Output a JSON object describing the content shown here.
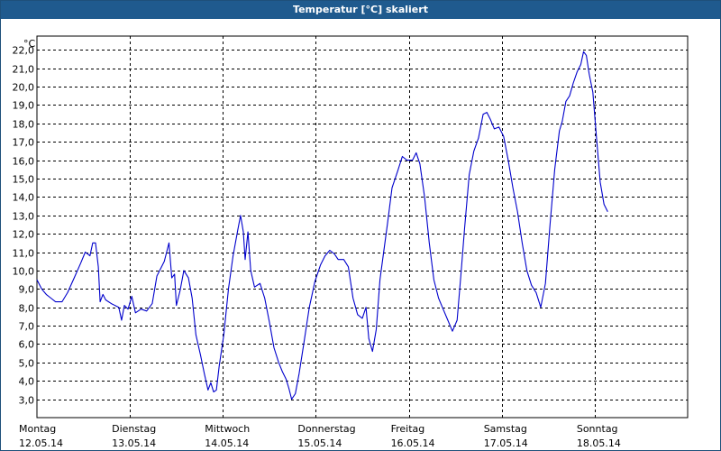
{
  "window": {
    "title": "Temperatur [°C] skaliert"
  },
  "chart_data": {
    "type": "line",
    "title": "Temperatur [°C] skaliert",
    "unit": "°C",
    "ylim": [
      2.0,
      22.75
    ],
    "xlim": [
      0,
      7.0
    ],
    "grid": true,
    "grid_style": "dashed",
    "yticks": [
      3.0,
      4.0,
      5.0,
      6.0,
      7.0,
      8.0,
      9.0,
      10.0,
      11.0,
      12.0,
      13.0,
      14.0,
      15.0,
      16.0,
      17.0,
      18.0,
      19.0,
      20.0,
      21.0,
      22.0
    ],
    "ytick_labels": [
      "3,0",
      "4,0",
      "5,0",
      "6,0",
      "7,0",
      "8,0",
      "9,0",
      "10,0",
      "11,0",
      "12,0",
      "13,0",
      "14,0",
      "15,0",
      "16,0",
      "17,0",
      "18,0",
      "19,0",
      "20,0",
      "21,0",
      "22,0"
    ],
    "days": [
      {
        "name": "Montag",
        "date": "12.05.14"
      },
      {
        "name": "Dienstag",
        "date": "13.05.14"
      },
      {
        "name": "Mittwoch",
        "date": "14.05.14"
      },
      {
        "name": "Donnerstag",
        "date": "15.05.14"
      },
      {
        "name": "Freitag",
        "date": "16.05.14"
      },
      {
        "name": "Samstag",
        "date": "17.05.14"
      },
      {
        "name": "Sonntag",
        "date": "18.05.14"
      }
    ],
    "series": [
      {
        "color": "#0000cc",
        "points": [
          [
            0.0,
            9.5
          ],
          [
            0.05,
            9.0
          ],
          [
            0.1,
            8.7
          ],
          [
            0.15,
            8.5
          ],
          [
            0.2,
            8.3
          ],
          [
            0.27,
            8.3
          ],
          [
            0.33,
            8.8
          ],
          [
            0.4,
            9.6
          ],
          [
            0.47,
            10.4
          ],
          [
            0.52,
            11.0
          ],
          [
            0.57,
            10.8
          ],
          [
            0.6,
            11.5
          ],
          [
            0.63,
            11.5
          ],
          [
            0.66,
            10.2
          ],
          [
            0.68,
            8.3
          ],
          [
            0.71,
            8.7
          ],
          [
            0.74,
            8.4
          ],
          [
            0.8,
            8.2
          ],
          [
            0.88,
            8.0
          ],
          [
            0.91,
            7.3
          ],
          [
            0.94,
            8.1
          ],
          [
            0.98,
            7.9
          ],
          [
            1.02,
            8.6
          ],
          [
            1.06,
            7.7
          ],
          [
            1.12,
            7.9
          ],
          [
            1.18,
            7.8
          ],
          [
            1.24,
            8.2
          ],
          [
            1.29,
            9.7
          ],
          [
            1.33,
            10.1
          ],
          [
            1.37,
            10.5
          ],
          [
            1.42,
            11.5
          ],
          [
            1.45,
            9.6
          ],
          [
            1.48,
            9.8
          ],
          [
            1.5,
            8.1
          ],
          [
            1.54,
            8.9
          ],
          [
            1.58,
            10.0
          ],
          [
            1.63,
            9.6
          ],
          [
            1.67,
            8.5
          ],
          [
            1.71,
            6.5
          ],
          [
            1.76,
            5.4
          ],
          [
            1.8,
            4.4
          ],
          [
            1.84,
            3.5
          ],
          [
            1.87,
            3.9
          ],
          [
            1.9,
            3.4
          ],
          [
            1.93,
            3.5
          ],
          [
            1.96,
            4.8
          ],
          [
            2.01,
            6.5
          ],
          [
            2.06,
            9.0
          ],
          [
            2.11,
            10.8
          ],
          [
            2.16,
            12.2
          ],
          [
            2.19,
            13.0
          ],
          [
            2.22,
            12.1
          ],
          [
            2.24,
            10.6
          ],
          [
            2.27,
            12.1
          ],
          [
            2.3,
            10.0
          ],
          [
            2.34,
            9.1
          ],
          [
            2.4,
            9.3
          ],
          [
            2.45,
            8.5
          ],
          [
            2.5,
            7.2
          ],
          [
            2.55,
            5.8
          ],
          [
            2.6,
            5.0
          ],
          [
            2.64,
            4.5
          ],
          [
            2.68,
            4.1
          ],
          [
            2.71,
            3.6
          ],
          [
            2.74,
            3.0
          ],
          [
            2.78,
            3.3
          ],
          [
            2.82,
            4.4
          ],
          [
            2.87,
            6.0
          ],
          [
            2.93,
            8.0
          ],
          [
            2.99,
            9.4
          ],
          [
            3.05,
            10.3
          ],
          [
            3.1,
            10.8
          ],
          [
            3.15,
            11.1
          ],
          [
            3.2,
            10.9
          ],
          [
            3.24,
            10.6
          ],
          [
            3.3,
            10.6
          ],
          [
            3.35,
            10.2
          ],
          [
            3.4,
            8.5
          ],
          [
            3.45,
            7.6
          ],
          [
            3.5,
            7.4
          ],
          [
            3.54,
            8.0
          ],
          [
            3.57,
            6.3
          ],
          [
            3.61,
            5.6
          ],
          [
            3.65,
            6.8
          ],
          [
            3.69,
            9.5
          ],
          [
            3.73,
            11.0
          ],
          [
            3.77,
            12.5
          ],
          [
            3.82,
            14.5
          ],
          [
            3.88,
            15.4
          ],
          [
            3.93,
            16.2
          ],
          [
            3.98,
            16.0
          ],
          [
            4.04,
            16.0
          ],
          [
            4.08,
            16.4
          ],
          [
            4.12,
            15.8
          ],
          [
            4.17,
            14.0
          ],
          [
            4.22,
            11.5
          ],
          [
            4.27,
            9.5
          ],
          [
            4.32,
            8.5
          ],
          [
            4.37,
            7.9
          ],
          [
            4.42,
            7.3
          ],
          [
            4.47,
            6.7
          ],
          [
            4.52,
            7.3
          ],
          [
            4.56,
            9.7
          ],
          [
            4.6,
            12.3
          ],
          [
            4.65,
            15.2
          ],
          [
            4.7,
            16.5
          ],
          [
            4.75,
            17.2
          ],
          [
            4.8,
            18.5
          ],
          [
            4.84,
            18.6
          ],
          [
            4.88,
            18.2
          ],
          [
            4.92,
            17.7
          ],
          [
            4.97,
            17.8
          ],
          [
            5.02,
            17.3
          ],
          [
            5.07,
            16.0
          ],
          [
            5.12,
            14.5
          ],
          [
            5.17,
            13.2
          ],
          [
            5.22,
            11.5
          ],
          [
            5.27,
            10.0
          ],
          [
            5.32,
            9.2
          ],
          [
            5.37,
            8.8
          ],
          [
            5.42,
            8.0
          ],
          [
            5.47,
            9.3
          ],
          [
            5.52,
            12.5
          ],
          [
            5.57,
            15.5
          ],
          [
            5.62,
            17.6
          ],
          [
            5.65,
            18.1
          ],
          [
            5.69,
            19.2
          ],
          [
            5.73,
            19.5
          ],
          [
            5.77,
            20.2
          ],
          [
            5.81,
            20.8
          ],
          [
            5.85,
            21.2
          ],
          [
            5.88,
            21.9
          ],
          [
            5.91,
            21.7
          ],
          [
            5.94,
            20.7
          ],
          [
            5.98,
            19.7
          ],
          [
            6.02,
            17.2
          ],
          [
            6.06,
            14.8
          ],
          [
            6.1,
            13.6
          ],
          [
            6.14,
            13.2
          ]
        ]
      }
    ]
  }
}
